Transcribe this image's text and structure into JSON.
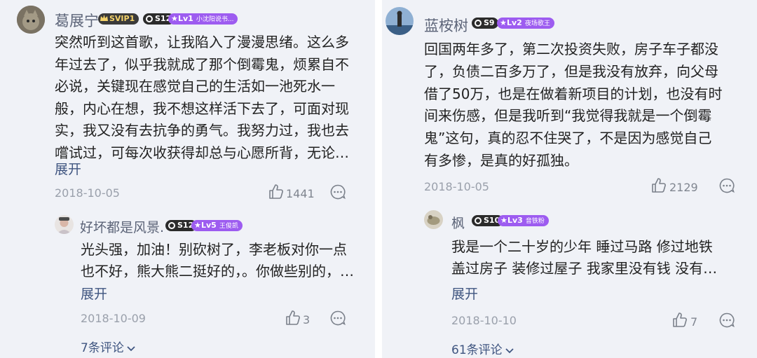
{
  "left": {
    "comment": {
      "username": "葛展宁",
      "svip_badge": "SVIP1",
      "s_badge": "S12",
      "lv_badge": "Lv1",
      "lv_title": "小沈阳说书...",
      "lines": [
        "突然听到这首歌，让我陷入了漫漫思绪。这么多",
        "年过去了，似乎我就成了那个倒霉鬼，烦累自不",
        "必说，关键现在感觉自己的生活如一池死水一",
        "般，内心在想，我不想这样活下去了，可面对现",
        "实，我又没有去抗争的勇气。我努力过，我也去",
        "嚐试过，可每次收获得却总与心愿所背，无论…"
      ],
      "expand": "展开",
      "date": "2018-10-05",
      "likes": "1441"
    },
    "reply": {
      "username": "好坏都是风景.",
      "s_badge": "S12",
      "lv_badge": "Lv5",
      "lv_title": "王俊凯",
      "lines": [
        "光头强，加油！别砍树了，李老板对你一点",
        "也不好，熊大熊二挺好的，。你做些别的，…"
      ],
      "expand": "展开",
      "date": "2018-10-09",
      "likes": "3"
    },
    "more_comments": "7条评论"
  },
  "right": {
    "comment": {
      "username": "蓝桉树",
      "s_badge": "S9",
      "lv_badge": "Lv2",
      "lv_title": "夜场歌王",
      "lines": [
        "回国两年多了，第二次投资失败，房子车子都没",
        "了，负债二百多万了，但是我没有放弃，向父母",
        "借了50万，也是在做着新项目的计划，也没有时",
        "间来伤感，但是我听到“我觉得我就是一个倒霉",
        "鬼”这句，真的忍不住哭了，不是因为感觉自己",
        "有多惨，是真的好孤独。"
      ],
      "date": "2018-10-05",
      "likes": "2129"
    },
    "reply": {
      "username": "枫",
      "s_badge": "S10",
      "lv_badge": "Lv3",
      "lv_title": "音铁粉",
      "lines": [
        "我是一个二十岁的少年 睡过马路 修过地铁",
        "盖过房子 装修过屋子 我家里没有钱 没有…"
      ],
      "expand": "展开",
      "date": "2018-10-10",
      "likes": "7"
    },
    "more_comments": "61条评论"
  },
  "colors": {
    "background": "#f0f2f7",
    "username": "#5c6478",
    "link": "#3f5580",
    "lv_badge": "#9d5cf0",
    "meta": "#9aa0ab"
  }
}
